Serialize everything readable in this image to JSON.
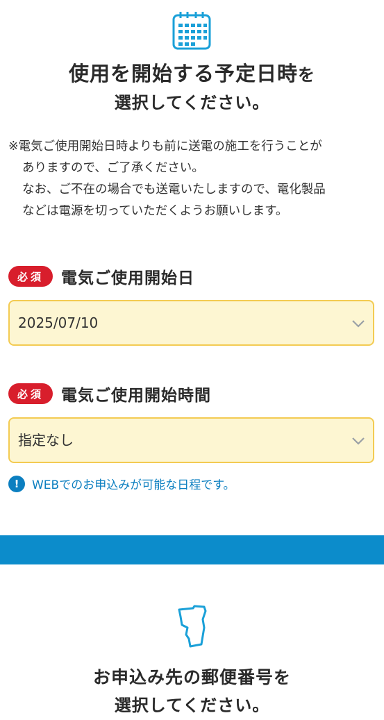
{
  "icons": {
    "calendar": "calendar-icon",
    "map": "map-region-icon",
    "chevron": "chevron-down-icon",
    "info": "info-icon"
  },
  "colors": {
    "accent_blue": "#0c8ccb",
    "required_red": "#d81e2c",
    "select_bg": "#fdf6d2",
    "select_border": "#f3cb52"
  },
  "section1": {
    "title_line1_main": "使用を開始する予定日時",
    "title_line1_particle": "を",
    "title_line2": "選択してください。",
    "notes": [
      "※電気ご使用開始日時よりも前に送電の施工を行うことが",
      "ありますので、ご了承ください。",
      "なお、ご不在の場合でも送電いたしますので、電化製品",
      "などは電源を切っていただくようお願いします。"
    ]
  },
  "fields": {
    "required_badge": "必須",
    "start_date": {
      "label": "電気ご使用開始日",
      "value": "2025/07/10"
    },
    "start_time": {
      "label": "電気ご使用開始時間",
      "value": "指定なし"
    }
  },
  "info": {
    "icon_glyph": "!",
    "text": "WEBでのお申込みが可能な日程です。"
  },
  "section2": {
    "title_line1_main": "お申込み先の郵便番号",
    "title_line1_particle": "を",
    "title_line2": "選択してください。"
  }
}
